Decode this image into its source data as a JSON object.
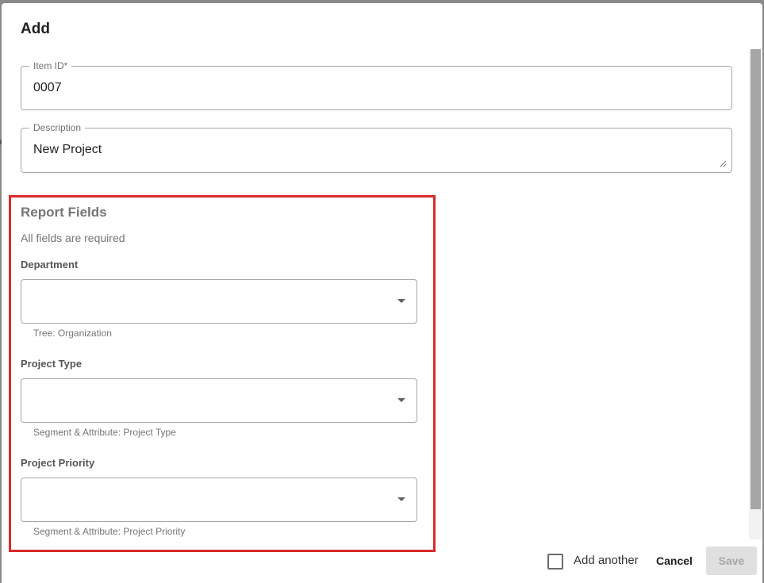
{
  "dialog": {
    "title": "Add",
    "item_id": {
      "label": "Item ID*",
      "value": "0007"
    },
    "description": {
      "label": "Description",
      "value": "New Project"
    }
  },
  "report_fields": {
    "title": "Report Fields",
    "subtitle": "All fields are required",
    "fields": [
      {
        "label": "Department",
        "value": "",
        "helper": "Tree: Organization"
      },
      {
        "label": "Project Type",
        "value": "",
        "helper": "Segment & Attribute: Project Type"
      },
      {
        "label": "Project Priority",
        "value": "",
        "helper": "Segment & Attribute: Project Priority"
      }
    ]
  },
  "footer": {
    "add_another_label": "Add another",
    "add_another_checked": false,
    "cancel_label": "Cancel",
    "save_label": "Save"
  },
  "colors": {
    "highlight_border": "#d92b2b",
    "save_disabled_bg": "#e0e0e0",
    "field_border": "#a6a6a6"
  }
}
